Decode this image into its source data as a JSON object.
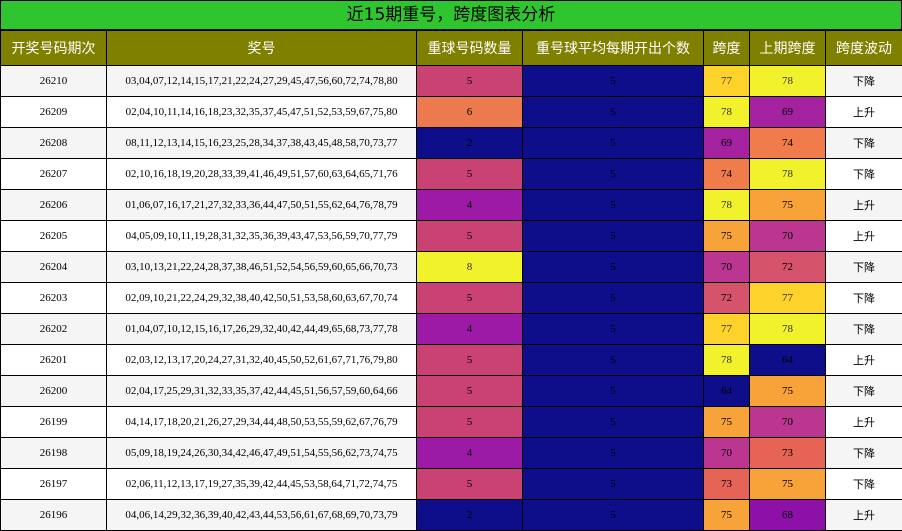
{
  "title": "近15期重号，跨度图表分析",
  "headers": [
    "开奖号码期次",
    "奖号",
    "重球号码数量",
    "重号球平均每期开出个数",
    "跨度",
    "上期跨度",
    "跨度波动"
  ],
  "rows": [
    {
      "period": "26210",
      "numbers": "03,04,07,12,14,15,17,21,22,24,27,29,45,47,56,60,72,74,78,80",
      "repeat_count": "5",
      "avg_repeat": "5",
      "span": "77",
      "prev_span": "78",
      "trend": "下降"
    },
    {
      "period": "26209",
      "numbers": "02,04,10,11,14,16,18,23,32,35,37,45,47,51,52,53,59,67,75,80",
      "repeat_count": "6",
      "avg_repeat": "5",
      "span": "78",
      "prev_span": "69",
      "trend": "上升"
    },
    {
      "period": "26208",
      "numbers": "08,11,12,13,14,15,16,23,25,28,34,37,38,43,45,48,58,70,73,77",
      "repeat_count": "2",
      "avg_repeat": "5",
      "span": "69",
      "prev_span": "74",
      "trend": "下降"
    },
    {
      "period": "26207",
      "numbers": "02,10,16,18,19,20,28,33,39,41,46,49,51,57,60,63,64,65,71,76",
      "repeat_count": "5",
      "avg_repeat": "5",
      "span": "74",
      "prev_span": "78",
      "trend": "下降"
    },
    {
      "period": "26206",
      "numbers": "01,06,07,16,17,21,27,32,33,36,44,47,50,51,55,62,64,76,78,79",
      "repeat_count": "4",
      "avg_repeat": "5",
      "span": "78",
      "prev_span": "75",
      "trend": "上升"
    },
    {
      "period": "26205",
      "numbers": "04,05,09,10,11,19,28,31,32,35,36,39,43,47,53,56,59,70,77,79",
      "repeat_count": "5",
      "avg_repeat": "5",
      "span": "75",
      "prev_span": "70",
      "trend": "上升"
    },
    {
      "period": "26204",
      "numbers": "03,10,13,21,22,24,28,37,38,46,51,52,54,56,59,60,65,66,70,73",
      "repeat_count": "8",
      "avg_repeat": "5",
      "span": "70",
      "prev_span": "72",
      "trend": "下降"
    },
    {
      "period": "26203",
      "numbers": "02,09,10,21,22,24,29,32,38,40,42,50,51,53,58,60,63,67,70,74",
      "repeat_count": "5",
      "avg_repeat": "5",
      "span": "72",
      "prev_span": "77",
      "trend": "下降"
    },
    {
      "period": "26202",
      "numbers": "01,04,07,10,12,15,16,17,26,29,32,40,42,44,49,65,68,73,77,78",
      "repeat_count": "4",
      "avg_repeat": "5",
      "span": "77",
      "prev_span": "78",
      "trend": "下降"
    },
    {
      "period": "26201",
      "numbers": "02,03,12,13,17,20,24,27,31,32,40,45,50,52,61,67,71,76,79,80",
      "repeat_count": "5",
      "avg_repeat": "5",
      "span": "78",
      "prev_span": "64",
      "trend": "上升"
    },
    {
      "period": "26200",
      "numbers": "02,04,17,25,29,31,32,33,35,37,42,44,45,51,56,57,59,60,64,66",
      "repeat_count": "5",
      "avg_repeat": "5",
      "span": "64",
      "prev_span": "75",
      "trend": "下降"
    },
    {
      "period": "26199",
      "numbers": "04,14,17,18,20,21,26,27,29,34,44,48,50,53,55,59,62,67,76,79",
      "repeat_count": "5",
      "avg_repeat": "5",
      "span": "75",
      "prev_span": "70",
      "trend": "上升"
    },
    {
      "period": "26198",
      "numbers": "05,09,18,19,24,26,30,34,42,46,47,49,51,54,55,56,62,73,74,75",
      "repeat_count": "4",
      "avg_repeat": "5",
      "span": "70",
      "prev_span": "73",
      "trend": "下降"
    },
    {
      "period": "26197",
      "numbers": "02,06,11,12,13,17,19,27,35,39,42,44,45,53,58,64,71,72,74,75",
      "repeat_count": "5",
      "avg_repeat": "5",
      "span": "73",
      "prev_span": "75",
      "trend": "下降"
    },
    {
      "period": "26196",
      "numbers": "04,06,14,29,32,36,39,40,42,43,44,53,56,61,67,68,69,70,73,79",
      "repeat_count": "2",
      "avg_repeat": "5",
      "span": "75",
      "prev_span": "68",
      "trend": "上升"
    }
  ],
  "value_colors": {
    "2": "#0e0e8a",
    "4": "#9d1aa6",
    "5": "#c94273",
    "6": "#ed7a4e",
    "8": "#f2f22c",
    "64": "#0e0e8a",
    "68": "#8d10a8",
    "69": "#a4229f",
    "70": "#bb3690",
    "72": "#d5546c",
    "73": "#e56456",
    "74": "#f07c4b",
    "75": "#f8a23a",
    "77": "#fdd22a",
    "78": "#f2f22c"
  },
  "dark_text_values": [
    "8",
    "77",
    "78"
  ]
}
